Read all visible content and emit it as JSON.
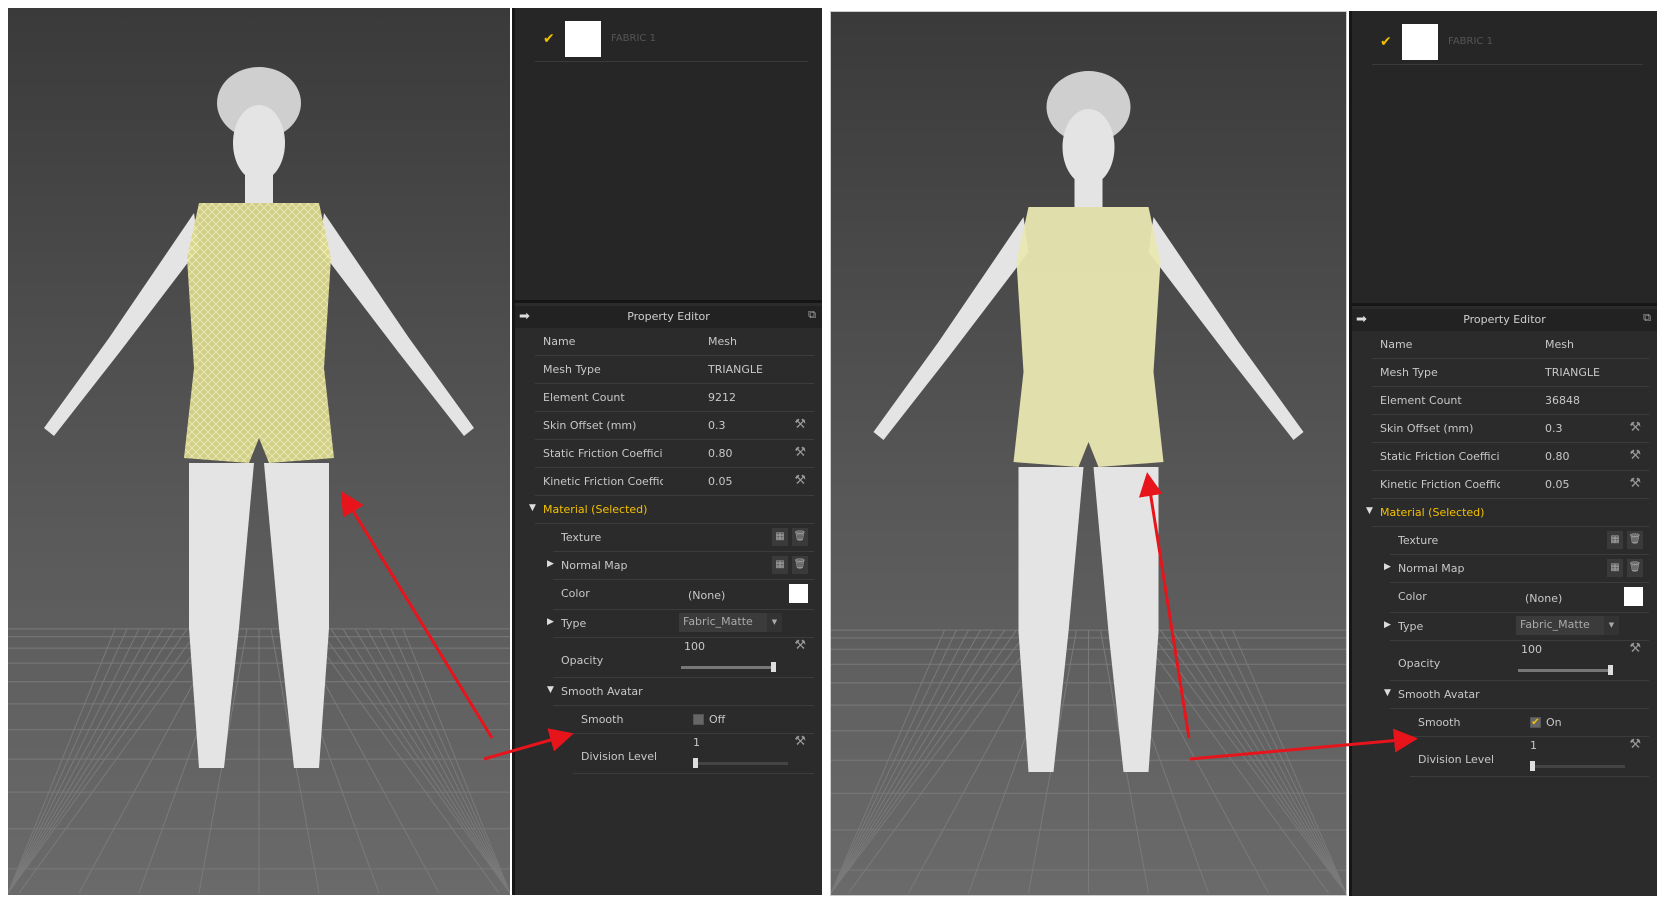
{
  "panels": [
    {
      "fabric": {
        "name": "FABRIC 1",
        "checked": true
      },
      "property_editor": {
        "title": "Property Editor",
        "rows": [
          {
            "label": "Name",
            "value": "Mesh"
          },
          {
            "label": "Mesh Type",
            "value": "TRIANGLE"
          },
          {
            "label": "Element Count",
            "value": "9212"
          },
          {
            "label": "Skin Offset (mm)",
            "value": "0.3"
          },
          {
            "label": "Static Friction Coefficient",
            "value": "0.80"
          },
          {
            "label": "Kinetic Friction Coefficient",
            "value": "0.05"
          }
        ],
        "material": {
          "header": "Material (Selected)",
          "texture_label": "Texture",
          "normal_map_label": "Normal Map",
          "color_label": "Color",
          "color_value": "(None)",
          "type_label": "Type",
          "type_value": "Fabric_Matte",
          "opacity_label": "Opacity",
          "opacity_value": "100",
          "opacity_fraction": 1.0
        },
        "smooth_avatar": {
          "header": "Smooth Avatar",
          "smooth_label": "Smooth",
          "smooth_checked": false,
          "smooth_state": "Off",
          "division_label": "Division Level",
          "division_value": "1",
          "division_fraction": 0.0
        }
      }
    },
    {
      "fabric": {
        "name": "FABRIC 1",
        "checked": true
      },
      "property_editor": {
        "title": "Property Editor",
        "rows": [
          {
            "label": "Name",
            "value": "Mesh"
          },
          {
            "label": "Mesh Type",
            "value": "TRIANGLE"
          },
          {
            "label": "Element Count",
            "value": "36848"
          },
          {
            "label": "Skin Offset (mm)",
            "value": "0.3"
          },
          {
            "label": "Static Friction Coefficient",
            "value": "0.80"
          },
          {
            "label": "Kinetic Friction Coefficient",
            "value": "0.05"
          }
        ],
        "material": {
          "header": "Material (Selected)",
          "texture_label": "Texture",
          "normal_map_label": "Normal Map",
          "color_label": "Color",
          "color_value": "(None)",
          "type_label": "Type",
          "type_value": "Fabric_Matte",
          "opacity_label": "Opacity",
          "opacity_value": "100",
          "opacity_fraction": 1.0
        },
        "smooth_avatar": {
          "header": "Smooth Avatar",
          "smooth_label": "Smooth",
          "smooth_checked": true,
          "smooth_state": "On",
          "division_label": "Division Level",
          "division_value": "1",
          "division_fraction": 0.0
        }
      }
    }
  ],
  "colors": {
    "accent": "#f5c000",
    "arrow": "#e8141c",
    "garment": "#e8e6a0"
  }
}
